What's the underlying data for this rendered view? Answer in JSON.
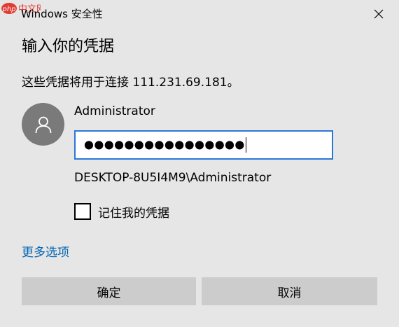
{
  "window": {
    "title": "Windows 安全性",
    "watermark_text": "中文网",
    "watermark_logo": "php",
    "watermark_color": "#e03c31"
  },
  "dialog": {
    "heading": "输入你的凭据",
    "description": "这些凭据将用于连接 111.231.69.181。",
    "username": "Administrator",
    "password_mask": "●●●●●●●●●●●●●●●●",
    "domain_user": "DESKTOP-8U5I4M9\\Administrator",
    "remember_label": "记住我的凭据",
    "remember_checked": false,
    "more_options": "更多选项",
    "ok_label": "确定",
    "cancel_label": "取消"
  },
  "icons": {
    "avatar": "user-avatar-icon",
    "close": "close-icon",
    "watermark": "php-logo-icon"
  },
  "colors": {
    "background": "#e6e6e6",
    "accent": "#2b78d6",
    "link": "#0063b1",
    "button": "#cccccc",
    "avatar": "#7a7a7a"
  }
}
